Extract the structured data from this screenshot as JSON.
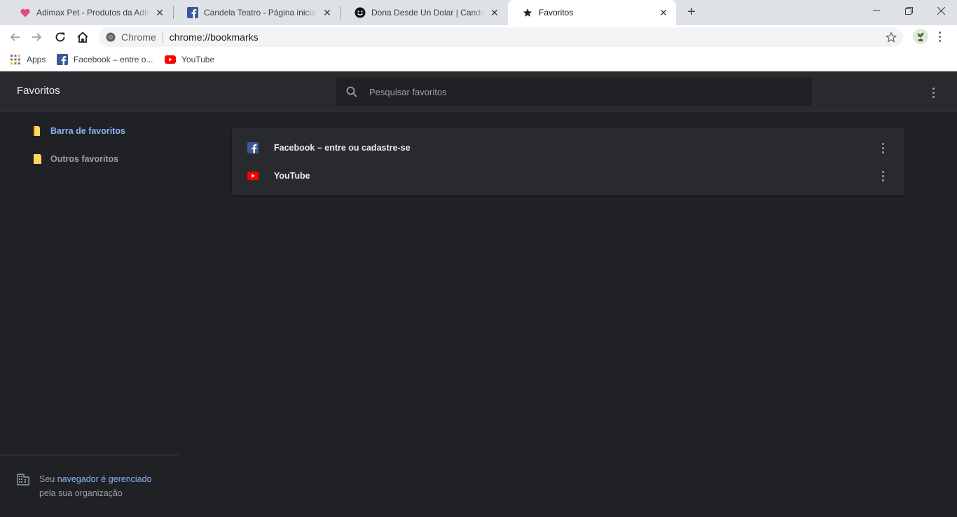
{
  "tabs": [
    {
      "title": "Adimax Pet - Produtos da Adimax",
      "icon": "heart-icon"
    },
    {
      "title": "Candela Teatro - Página inicial | Facebook",
      "icon": "facebook-icon"
    },
    {
      "title": "Dona Desde Un Dolar | Candela Teatro",
      "icon": "smiley-icon"
    },
    {
      "title": "Favoritos",
      "icon": "star-icon",
      "active": true
    }
  ],
  "omnibox": {
    "scheme_label": "Chrome",
    "url": "chrome://bookmarks"
  },
  "bookmarks_bar": [
    {
      "label": "Apps",
      "icon": "apps-grid-icon"
    },
    {
      "label": "Facebook – entre o...",
      "icon": "facebook-icon"
    },
    {
      "label": "YouTube",
      "icon": "youtube-icon"
    }
  ],
  "page": {
    "title": "Favoritos",
    "search_placeholder": "Pesquisar favoritos"
  },
  "sidebar": {
    "folders": [
      {
        "label": "Barra de favoritos",
        "selected": true
      },
      {
        "label": "Outros favoritos",
        "selected": false
      }
    ],
    "managed": {
      "prefix": "Seu ",
      "link": "navegador é gerenciado",
      "suffix": "pela sua organização"
    }
  },
  "list": [
    {
      "title": "Facebook – entre ou cadastre-se",
      "icon": "facebook-icon"
    },
    {
      "title": "YouTube",
      "icon": "youtube-icon"
    }
  ],
  "colors": {
    "accent": "#8ab4f8",
    "background": "#202124",
    "surface": "#292a2d"
  }
}
